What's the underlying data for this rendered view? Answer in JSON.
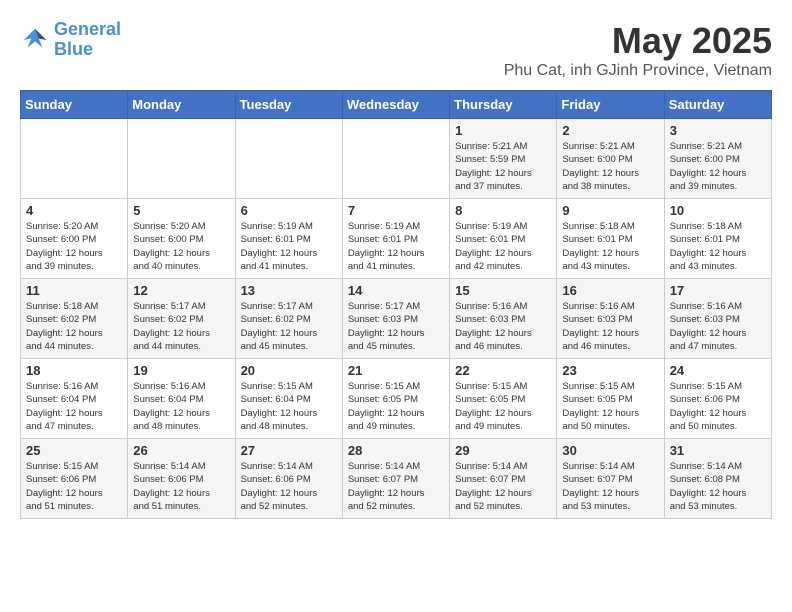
{
  "logo": {
    "line1": "General",
    "line2": "Blue"
  },
  "title": "May 2025",
  "subtitle": "Phu Cat, inh GJinh Province, Vietnam",
  "days_of_week": [
    "Sunday",
    "Monday",
    "Tuesday",
    "Wednesday",
    "Thursday",
    "Friday",
    "Saturday"
  ],
  "weeks": [
    [
      {
        "day": "",
        "info": ""
      },
      {
        "day": "",
        "info": ""
      },
      {
        "day": "",
        "info": ""
      },
      {
        "day": "",
        "info": ""
      },
      {
        "day": "1",
        "info": "Sunrise: 5:21 AM\nSunset: 5:59 PM\nDaylight: 12 hours\nand 37 minutes."
      },
      {
        "day": "2",
        "info": "Sunrise: 5:21 AM\nSunset: 6:00 PM\nDaylight: 12 hours\nand 38 minutes."
      },
      {
        "day": "3",
        "info": "Sunrise: 5:21 AM\nSunset: 6:00 PM\nDaylight: 12 hours\nand 39 minutes."
      }
    ],
    [
      {
        "day": "4",
        "info": "Sunrise: 5:20 AM\nSunset: 6:00 PM\nDaylight: 12 hours\nand 39 minutes."
      },
      {
        "day": "5",
        "info": "Sunrise: 5:20 AM\nSunset: 6:00 PM\nDaylight: 12 hours\nand 40 minutes."
      },
      {
        "day": "6",
        "info": "Sunrise: 5:19 AM\nSunset: 6:01 PM\nDaylight: 12 hours\nand 41 minutes."
      },
      {
        "day": "7",
        "info": "Sunrise: 5:19 AM\nSunset: 6:01 PM\nDaylight: 12 hours\nand 41 minutes."
      },
      {
        "day": "8",
        "info": "Sunrise: 5:19 AM\nSunset: 6:01 PM\nDaylight: 12 hours\nand 42 minutes."
      },
      {
        "day": "9",
        "info": "Sunrise: 5:18 AM\nSunset: 6:01 PM\nDaylight: 12 hours\nand 43 minutes."
      },
      {
        "day": "10",
        "info": "Sunrise: 5:18 AM\nSunset: 6:01 PM\nDaylight: 12 hours\nand 43 minutes."
      }
    ],
    [
      {
        "day": "11",
        "info": "Sunrise: 5:18 AM\nSunset: 6:02 PM\nDaylight: 12 hours\nand 44 minutes."
      },
      {
        "day": "12",
        "info": "Sunrise: 5:17 AM\nSunset: 6:02 PM\nDaylight: 12 hours\nand 44 minutes."
      },
      {
        "day": "13",
        "info": "Sunrise: 5:17 AM\nSunset: 6:02 PM\nDaylight: 12 hours\nand 45 minutes."
      },
      {
        "day": "14",
        "info": "Sunrise: 5:17 AM\nSunset: 6:03 PM\nDaylight: 12 hours\nand 45 minutes."
      },
      {
        "day": "15",
        "info": "Sunrise: 5:16 AM\nSunset: 6:03 PM\nDaylight: 12 hours\nand 46 minutes."
      },
      {
        "day": "16",
        "info": "Sunrise: 5:16 AM\nSunset: 6:03 PM\nDaylight: 12 hours\nand 46 minutes."
      },
      {
        "day": "17",
        "info": "Sunrise: 5:16 AM\nSunset: 6:03 PM\nDaylight: 12 hours\nand 47 minutes."
      }
    ],
    [
      {
        "day": "18",
        "info": "Sunrise: 5:16 AM\nSunset: 6:04 PM\nDaylight: 12 hours\nand 47 minutes."
      },
      {
        "day": "19",
        "info": "Sunrise: 5:16 AM\nSunset: 6:04 PM\nDaylight: 12 hours\nand 48 minutes."
      },
      {
        "day": "20",
        "info": "Sunrise: 5:15 AM\nSunset: 6:04 PM\nDaylight: 12 hours\nand 48 minutes."
      },
      {
        "day": "21",
        "info": "Sunrise: 5:15 AM\nSunset: 6:05 PM\nDaylight: 12 hours\nand 49 minutes."
      },
      {
        "day": "22",
        "info": "Sunrise: 5:15 AM\nSunset: 6:05 PM\nDaylight: 12 hours\nand 49 minutes."
      },
      {
        "day": "23",
        "info": "Sunrise: 5:15 AM\nSunset: 6:05 PM\nDaylight: 12 hours\nand 50 minutes."
      },
      {
        "day": "24",
        "info": "Sunrise: 5:15 AM\nSunset: 6:06 PM\nDaylight: 12 hours\nand 50 minutes."
      }
    ],
    [
      {
        "day": "25",
        "info": "Sunrise: 5:15 AM\nSunset: 6:06 PM\nDaylight: 12 hours\nand 51 minutes."
      },
      {
        "day": "26",
        "info": "Sunrise: 5:14 AM\nSunset: 6:06 PM\nDaylight: 12 hours\nand 51 minutes."
      },
      {
        "day": "27",
        "info": "Sunrise: 5:14 AM\nSunset: 6:06 PM\nDaylight: 12 hours\nand 52 minutes."
      },
      {
        "day": "28",
        "info": "Sunrise: 5:14 AM\nSunset: 6:07 PM\nDaylight: 12 hours\nand 52 minutes."
      },
      {
        "day": "29",
        "info": "Sunrise: 5:14 AM\nSunset: 6:07 PM\nDaylight: 12 hours\nand 52 minutes."
      },
      {
        "day": "30",
        "info": "Sunrise: 5:14 AM\nSunset: 6:07 PM\nDaylight: 12 hours\nand 53 minutes."
      },
      {
        "day": "31",
        "info": "Sunrise: 5:14 AM\nSunset: 6:08 PM\nDaylight: 12 hours\nand 53 minutes."
      }
    ]
  ]
}
